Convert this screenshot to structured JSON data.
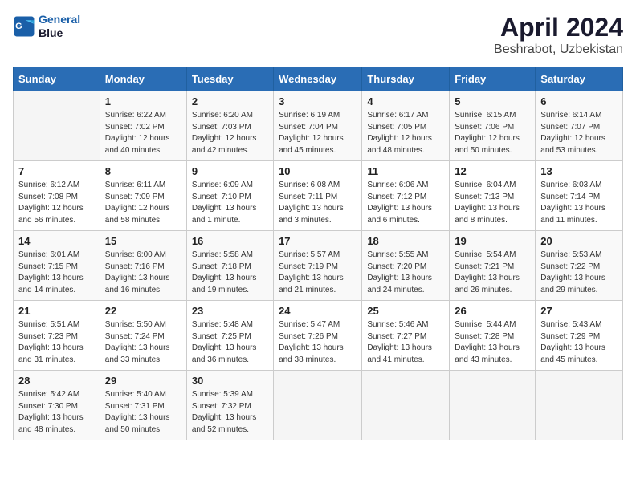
{
  "header": {
    "logo_line1": "General",
    "logo_line2": "Blue",
    "title": "April 2024",
    "subtitle": "Beshrabot, Uzbekistan"
  },
  "weekdays": [
    "Sunday",
    "Monday",
    "Tuesday",
    "Wednesday",
    "Thursday",
    "Friday",
    "Saturday"
  ],
  "weeks": [
    [
      {
        "day": "",
        "sunrise": "",
        "sunset": "",
        "daylight": ""
      },
      {
        "day": "1",
        "sunrise": "Sunrise: 6:22 AM",
        "sunset": "Sunset: 7:02 PM",
        "daylight": "Daylight: 12 hours and 40 minutes."
      },
      {
        "day": "2",
        "sunrise": "Sunrise: 6:20 AM",
        "sunset": "Sunset: 7:03 PM",
        "daylight": "Daylight: 12 hours and 42 minutes."
      },
      {
        "day": "3",
        "sunrise": "Sunrise: 6:19 AM",
        "sunset": "Sunset: 7:04 PM",
        "daylight": "Daylight: 12 hours and 45 minutes."
      },
      {
        "day": "4",
        "sunrise": "Sunrise: 6:17 AM",
        "sunset": "Sunset: 7:05 PM",
        "daylight": "Daylight: 12 hours and 48 minutes."
      },
      {
        "day": "5",
        "sunrise": "Sunrise: 6:15 AM",
        "sunset": "Sunset: 7:06 PM",
        "daylight": "Daylight: 12 hours and 50 minutes."
      },
      {
        "day": "6",
        "sunrise": "Sunrise: 6:14 AM",
        "sunset": "Sunset: 7:07 PM",
        "daylight": "Daylight: 12 hours and 53 minutes."
      }
    ],
    [
      {
        "day": "7",
        "sunrise": "Sunrise: 6:12 AM",
        "sunset": "Sunset: 7:08 PM",
        "daylight": "Daylight: 12 hours and 56 minutes."
      },
      {
        "day": "8",
        "sunrise": "Sunrise: 6:11 AM",
        "sunset": "Sunset: 7:09 PM",
        "daylight": "Daylight: 12 hours and 58 minutes."
      },
      {
        "day": "9",
        "sunrise": "Sunrise: 6:09 AM",
        "sunset": "Sunset: 7:10 PM",
        "daylight": "Daylight: 13 hours and 1 minute."
      },
      {
        "day": "10",
        "sunrise": "Sunrise: 6:08 AM",
        "sunset": "Sunset: 7:11 PM",
        "daylight": "Daylight: 13 hours and 3 minutes."
      },
      {
        "day": "11",
        "sunrise": "Sunrise: 6:06 AM",
        "sunset": "Sunset: 7:12 PM",
        "daylight": "Daylight: 13 hours and 6 minutes."
      },
      {
        "day": "12",
        "sunrise": "Sunrise: 6:04 AM",
        "sunset": "Sunset: 7:13 PM",
        "daylight": "Daylight: 13 hours and 8 minutes."
      },
      {
        "day": "13",
        "sunrise": "Sunrise: 6:03 AM",
        "sunset": "Sunset: 7:14 PM",
        "daylight": "Daylight: 13 hours and 11 minutes."
      }
    ],
    [
      {
        "day": "14",
        "sunrise": "Sunrise: 6:01 AM",
        "sunset": "Sunset: 7:15 PM",
        "daylight": "Daylight: 13 hours and 14 minutes."
      },
      {
        "day": "15",
        "sunrise": "Sunrise: 6:00 AM",
        "sunset": "Sunset: 7:16 PM",
        "daylight": "Daylight: 13 hours and 16 minutes."
      },
      {
        "day": "16",
        "sunrise": "Sunrise: 5:58 AM",
        "sunset": "Sunset: 7:18 PM",
        "daylight": "Daylight: 13 hours and 19 minutes."
      },
      {
        "day": "17",
        "sunrise": "Sunrise: 5:57 AM",
        "sunset": "Sunset: 7:19 PM",
        "daylight": "Daylight: 13 hours and 21 minutes."
      },
      {
        "day": "18",
        "sunrise": "Sunrise: 5:55 AM",
        "sunset": "Sunset: 7:20 PM",
        "daylight": "Daylight: 13 hours and 24 minutes."
      },
      {
        "day": "19",
        "sunrise": "Sunrise: 5:54 AM",
        "sunset": "Sunset: 7:21 PM",
        "daylight": "Daylight: 13 hours and 26 minutes."
      },
      {
        "day": "20",
        "sunrise": "Sunrise: 5:53 AM",
        "sunset": "Sunset: 7:22 PM",
        "daylight": "Daylight: 13 hours and 29 minutes."
      }
    ],
    [
      {
        "day": "21",
        "sunrise": "Sunrise: 5:51 AM",
        "sunset": "Sunset: 7:23 PM",
        "daylight": "Daylight: 13 hours and 31 minutes."
      },
      {
        "day": "22",
        "sunrise": "Sunrise: 5:50 AM",
        "sunset": "Sunset: 7:24 PM",
        "daylight": "Daylight: 13 hours and 33 minutes."
      },
      {
        "day": "23",
        "sunrise": "Sunrise: 5:48 AM",
        "sunset": "Sunset: 7:25 PM",
        "daylight": "Daylight: 13 hours and 36 minutes."
      },
      {
        "day": "24",
        "sunrise": "Sunrise: 5:47 AM",
        "sunset": "Sunset: 7:26 PM",
        "daylight": "Daylight: 13 hours and 38 minutes."
      },
      {
        "day": "25",
        "sunrise": "Sunrise: 5:46 AM",
        "sunset": "Sunset: 7:27 PM",
        "daylight": "Daylight: 13 hours and 41 minutes."
      },
      {
        "day": "26",
        "sunrise": "Sunrise: 5:44 AM",
        "sunset": "Sunset: 7:28 PM",
        "daylight": "Daylight: 13 hours and 43 minutes."
      },
      {
        "day": "27",
        "sunrise": "Sunrise: 5:43 AM",
        "sunset": "Sunset: 7:29 PM",
        "daylight": "Daylight: 13 hours and 45 minutes."
      }
    ],
    [
      {
        "day": "28",
        "sunrise": "Sunrise: 5:42 AM",
        "sunset": "Sunset: 7:30 PM",
        "daylight": "Daylight: 13 hours and 48 minutes."
      },
      {
        "day": "29",
        "sunrise": "Sunrise: 5:40 AM",
        "sunset": "Sunset: 7:31 PM",
        "daylight": "Daylight: 13 hours and 50 minutes."
      },
      {
        "day": "30",
        "sunrise": "Sunrise: 5:39 AM",
        "sunset": "Sunset: 7:32 PM",
        "daylight": "Daylight: 13 hours and 52 minutes."
      },
      {
        "day": "",
        "sunrise": "",
        "sunset": "",
        "daylight": ""
      },
      {
        "day": "",
        "sunrise": "",
        "sunset": "",
        "daylight": ""
      },
      {
        "day": "",
        "sunrise": "",
        "sunset": "",
        "daylight": ""
      },
      {
        "day": "",
        "sunrise": "",
        "sunset": "",
        "daylight": ""
      }
    ]
  ]
}
